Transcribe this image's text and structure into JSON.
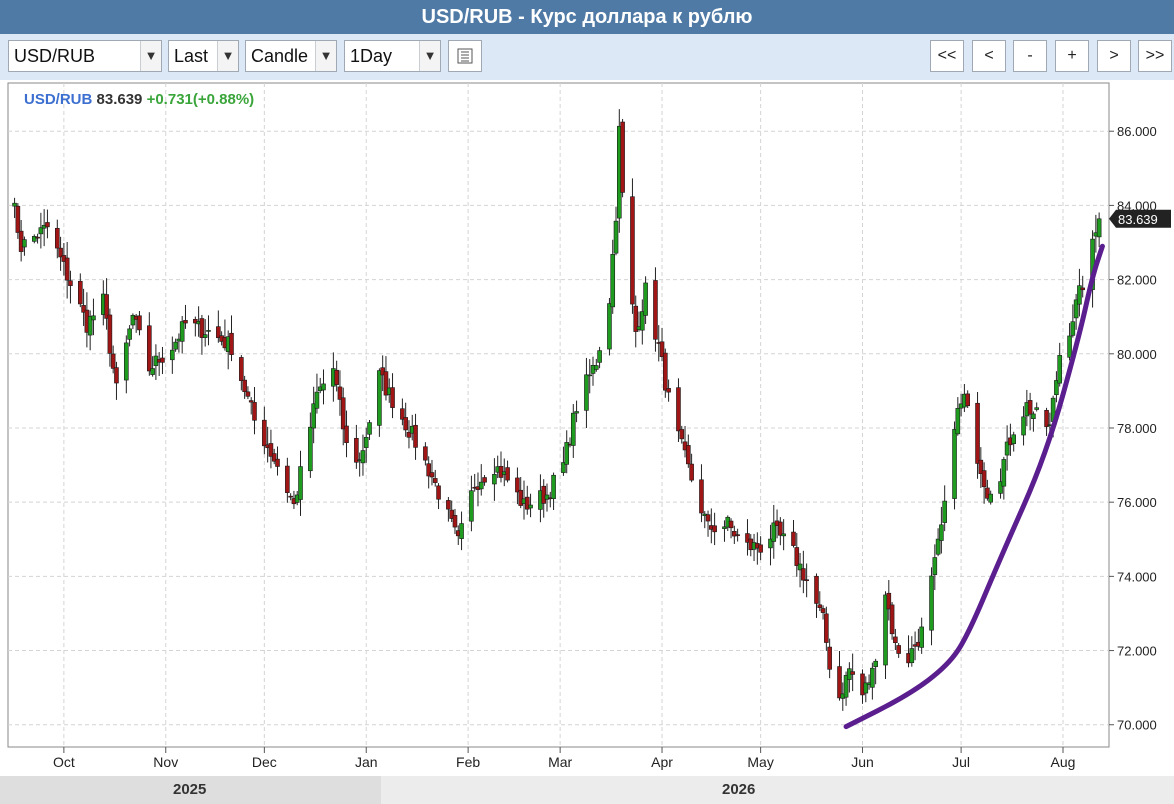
{
  "title": "USD/RUB - Курс доллара к рублю",
  "toolbar": {
    "symbol": "USD/RUB",
    "field": "Last",
    "chart_style": "Candle",
    "interval": "1Day",
    "nav_buttons": [
      "<<",
      "<",
      "-",
      "+",
      ">",
      ">>"
    ]
  },
  "info": {
    "symbol": "USD/RUB",
    "last": "83.639",
    "change": "+0.731(+0.88%)"
  },
  "colors": {
    "up": "#1f9b1f",
    "down": "#a01515",
    "trend": "#5b1e8f",
    "info_symbol": "#3c6fd0",
    "info_change": "#3aa53a"
  },
  "chart_data": {
    "type": "candlestick",
    "series_name": "USD/RUB",
    "last_value": "83.639",
    "ylim": [
      69.4,
      87.3
    ],
    "y_ticks": [
      70,
      72,
      74,
      76,
      78,
      80,
      82,
      84,
      86
    ],
    "y_tick_labels": [
      "70.000",
      "72.000",
      "74.000",
      "76.000",
      "78.000",
      "80.000",
      "82.000",
      "84.000",
      "86.000"
    ],
    "x_range": [
      "2025-09-14",
      "2026-08-15"
    ],
    "x_ticks": [
      {
        "date": "2025-10-01",
        "label": "Oct"
      },
      {
        "date": "2025-11-01",
        "label": "Nov"
      },
      {
        "date": "2025-12-01",
        "label": "Dec"
      },
      {
        "date": "2026-01-01",
        "label": "Jan"
      },
      {
        "date": "2026-02-01",
        "label": "Feb"
      },
      {
        "date": "2026-03-01",
        "label": "Mar"
      },
      {
        "date": "2026-04-01",
        "label": "Apr"
      },
      {
        "date": "2026-05-01",
        "label": "May"
      },
      {
        "date": "2026-06-01",
        "label": "Jun"
      },
      {
        "date": "2026-07-01",
        "label": "Jul"
      },
      {
        "date": "2026-08-01",
        "label": "Aug"
      }
    ],
    "years": [
      {
        "label": "2025"
      },
      {
        "label": "2026"
      }
    ],
    "close_keypoints": [
      [
        "2025-09-14",
        84.8
      ],
      [
        "2025-09-18",
        82.9
      ],
      [
        "2025-09-26",
        83.4
      ],
      [
        "2025-10-03",
        81.9
      ],
      [
        "2025-10-08",
        80.8
      ],
      [
        "2025-10-13",
        81.4
      ],
      [
        "2025-10-17",
        79.0
      ],
      [
        "2025-10-22",
        81.0
      ],
      [
        "2025-10-27",
        79.6
      ],
      [
        "2025-11-03",
        80.2
      ],
      [
        "2025-11-07",
        80.8
      ],
      [
        "2025-11-14",
        80.6
      ],
      [
        "2025-11-21",
        80.2
      ],
      [
        "2025-11-28",
        78.2
      ],
      [
        "2025-12-05",
        77.0
      ],
      [
        "2025-12-10",
        75.9
      ],
      [
        "2025-12-17",
        78.9
      ],
      [
        "2025-12-22",
        79.6
      ],
      [
        "2025-12-26",
        77.5
      ],
      [
        "2025-12-30",
        77.1
      ],
      [
        "2026-01-02",
        78.2
      ],
      [
        "2026-01-05",
        79.4
      ],
      [
        "2026-01-10",
        78.6
      ],
      [
        "2026-01-15",
        77.8
      ],
      [
        "2026-01-21",
        76.7
      ],
      [
        "2026-01-26",
        75.6
      ],
      [
        "2026-01-29",
        74.9
      ],
      [
        "2026-02-03",
        76.5
      ],
      [
        "2026-02-09",
        77.0
      ],
      [
        "2026-02-13",
        76.6
      ],
      [
        "2026-02-18",
        75.9
      ],
      [
        "2026-02-25",
        76.2
      ],
      [
        "2026-03-02",
        77.0
      ],
      [
        "2026-03-06",
        78.6
      ],
      [
        "2026-03-12",
        79.8
      ],
      [
        "2026-03-16",
        81.5
      ],
      [
        "2026-03-18",
        83.8
      ],
      [
        "2026-03-19",
        86.0
      ],
      [
        "2026-03-21",
        82.5
      ],
      [
        "2026-03-24",
        80.6
      ],
      [
        "2026-03-27",
        81.7
      ],
      [
        "2026-03-31",
        80.2
      ],
      [
        "2026-04-04",
        78.3
      ],
      [
        "2026-04-09",
        76.9
      ],
      [
        "2026-04-15",
        75.3
      ],
      [
        "2026-04-21",
        75.4
      ],
      [
        "2026-04-26",
        74.8
      ],
      [
        "2026-05-01",
        74.8
      ],
      [
        "2026-05-05",
        75.2
      ],
      [
        "2026-05-10",
        74.8
      ],
      [
        "2026-05-15",
        73.9
      ],
      [
        "2026-05-20",
        72.8
      ],
      [
        "2026-05-24",
        70.5
      ],
      [
        "2026-05-28",
        71.5
      ],
      [
        "2026-06-01",
        70.8
      ],
      [
        "2026-06-04",
        71.4
      ],
      [
        "2026-06-08",
        73.6
      ],
      [
        "2026-06-11",
        72.1
      ],
      [
        "2026-06-15",
        71.8
      ],
      [
        "2026-06-19",
        72.5
      ],
      [
        "2026-06-23",
        74.3
      ],
      [
        "2026-06-26",
        75.8
      ],
      [
        "2026-06-29",
        78.2
      ],
      [
        "2026-07-02",
        78.8
      ],
      [
        "2026-07-05",
        77.6
      ],
      [
        "2026-07-09",
        76.3
      ],
      [
        "2026-07-13",
        76.8
      ],
      [
        "2026-07-17",
        78.0
      ],
      [
        "2026-07-21",
        78.6
      ],
      [
        "2026-07-24",
        78.3
      ],
      [
        "2026-07-28",
        78.0
      ],
      [
        "2026-07-31",
        80.0
      ],
      [
        "2026-08-03",
        80.7
      ],
      [
        "2026-08-06",
        81.6
      ],
      [
        "2026-08-09",
        82.5
      ],
      [
        "2026-08-12",
        83.639
      ]
    ],
    "trend_line": {
      "color": "#5b1e8f",
      "points": [
        [
          "2026-05-27",
          69.95
        ],
        [
          "2026-06-15",
          70.8
        ],
        [
          "2026-06-27",
          71.6
        ],
        [
          "2026-07-03",
          72.4
        ],
        [
          "2026-07-13",
          74.5
        ],
        [
          "2026-07-27",
          77.3
        ],
        [
          "2026-08-06",
          80.5
        ],
        [
          "2026-08-10",
          82.1
        ],
        [
          "2026-08-13",
          82.9
        ]
      ]
    }
  }
}
